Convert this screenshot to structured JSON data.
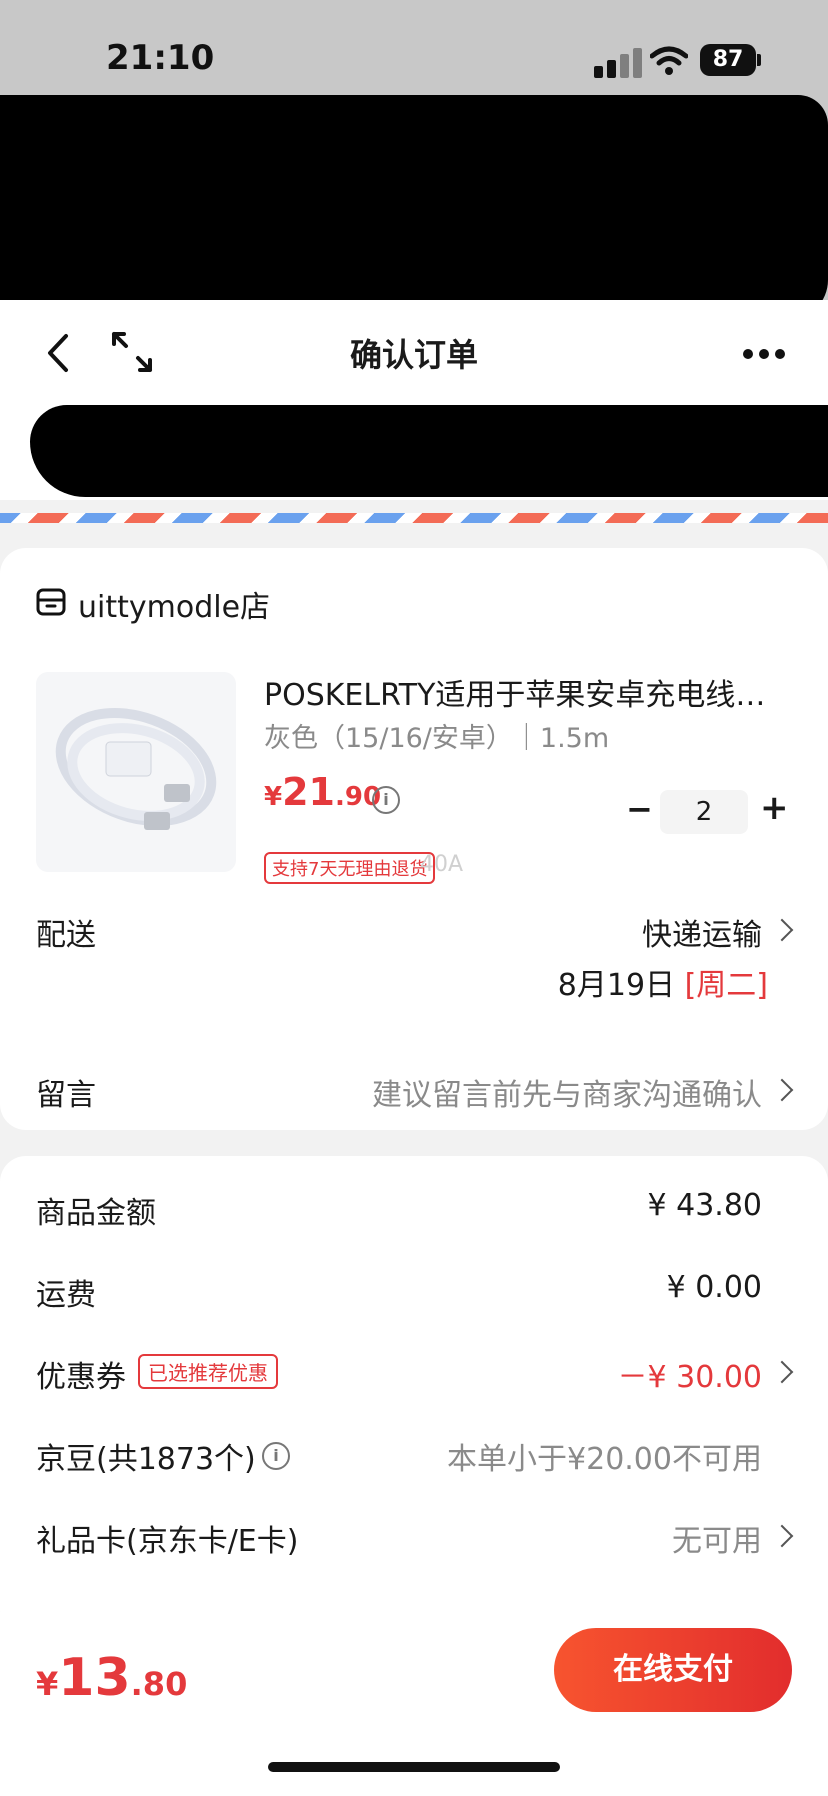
{
  "status_bar": {
    "time": "21:10",
    "battery": "87"
  },
  "nav": {
    "title": "确认订单"
  },
  "store": {
    "name": "uittymodle店"
  },
  "product": {
    "title": "POSKELRTY适用于苹果安卓充电线…",
    "spec": "灰色（15/16/安卓）｜1.5m",
    "price_yen": "¥",
    "price_int": "21",
    "price_dec": ".90",
    "quantity": "2",
    "minus": "−",
    "plus": "+",
    "return_badge": "支持7天无理由退货",
    "watermark": "40A"
  },
  "delivery": {
    "label": "配送",
    "method": "快递运输",
    "date": "8月19日",
    "weekday": "[周二]"
  },
  "message": {
    "label": "留言",
    "placeholder": "建议留言前先与商家沟通确认"
  },
  "summary": {
    "goods_label": "商品金额",
    "goods_value": "¥ 43.80",
    "shipping_label": "运费",
    "shipping_value": "¥ 0.00",
    "coupon_label": "优惠券",
    "coupon_badge": "已选推荐优惠",
    "coupon_value": "－¥ 30.00",
    "beans_label": "京豆(共1873个)",
    "beans_value": "本单小于¥20.00不可用",
    "gift_label": "礼品卡(京东卡/E卡)",
    "gift_value": "无可用"
  },
  "footer": {
    "total_yen": "¥",
    "total_int": "13",
    "total_dec": ".80",
    "pay_label": "在线支付"
  },
  "colors": {
    "accent": "#e4393c",
    "pay_button": "#f04a2c"
  },
  "icons": [
    "back-icon",
    "expand-icon",
    "more-icon",
    "store-icon",
    "info-icon",
    "chevron-right-icon",
    "wifi-icon",
    "signal-icon",
    "battery-icon"
  ]
}
